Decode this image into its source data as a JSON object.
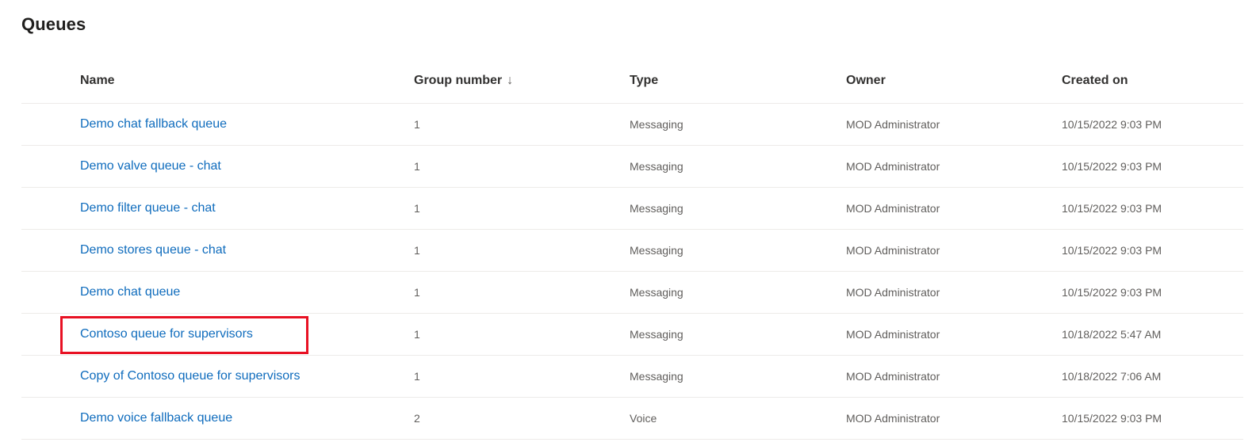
{
  "page": {
    "title": "Queues"
  },
  "columns": {
    "name": "Name",
    "group_number": "Group number",
    "sort_indicator": "↓",
    "type": "Type",
    "owner": "Owner",
    "created_on": "Created on"
  },
  "rows": [
    {
      "name": "Demo chat fallback queue",
      "group": "1",
      "type": "Messaging",
      "owner": "MOD Administrator",
      "created": "10/15/2022 9:03 PM"
    },
    {
      "name": "Demo valve queue - chat",
      "group": "1",
      "type": "Messaging",
      "owner": "MOD Administrator",
      "created": "10/15/2022 9:03 PM"
    },
    {
      "name": "Demo filter queue - chat",
      "group": "1",
      "type": "Messaging",
      "owner": "MOD Administrator",
      "created": "10/15/2022 9:03 PM"
    },
    {
      "name": "Demo stores queue - chat",
      "group": "1",
      "type": "Messaging",
      "owner": "MOD Administrator",
      "created": "10/15/2022 9:03 PM"
    },
    {
      "name": "Demo chat queue",
      "group": "1",
      "type": "Messaging",
      "owner": "MOD Administrator",
      "created": "10/15/2022 9:03 PM"
    },
    {
      "name": "Contoso queue for supervisors",
      "group": "1",
      "type": "Messaging",
      "owner": "MOD Administrator",
      "created": "10/18/2022 5:47 AM"
    },
    {
      "name": "Copy of Contoso queue for supervisors",
      "group": "1",
      "type": "Messaging",
      "owner": "MOD Administrator",
      "created": "10/18/2022 7:06 AM"
    },
    {
      "name": "Demo voice fallback queue",
      "group": "2",
      "type": "Voice",
      "owner": "MOD Administrator",
      "created": "10/15/2022 9:03 PM"
    }
  ],
  "colors": {
    "link": "#0f6cbd",
    "highlight": "#e81123"
  }
}
